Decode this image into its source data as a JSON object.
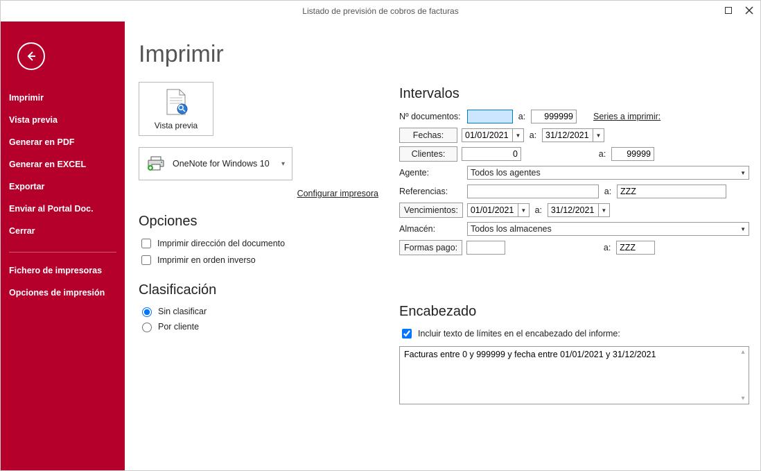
{
  "window": {
    "title": "Listado de previsión de cobros de facturas"
  },
  "sidebar": {
    "items": [
      "Imprimir",
      "Vista previa",
      "Generar en PDF",
      "Generar en EXCEL",
      "Exportar",
      "Enviar al Portal Doc.",
      "Cerrar"
    ],
    "items2": [
      "Fichero de impresoras",
      "Opciones de impresión"
    ]
  },
  "page": {
    "heading": "Imprimir",
    "preview_label": "Vista previa",
    "printer_name": "OneNote for Windows 10",
    "config_link": "Configurar impresora"
  },
  "opciones": {
    "heading": "Opciones",
    "cb1": "Imprimir dirección del documento",
    "cb2": "Imprimir en orden inverso"
  },
  "clasificacion": {
    "heading": "Clasificación",
    "r1": "Sin clasificar",
    "r2": "Por cliente"
  },
  "intervalos": {
    "heading": "Intervalos",
    "ndoc_label": "Nº documentos:",
    "ndoc_from": "",
    "a": "a:",
    "ndoc_to": "999999",
    "series_link": "Series a imprimir:",
    "fechas_btn": "Fechas:",
    "fecha_from": "01/01/2021",
    "fecha_to": "31/12/2021",
    "clientes_btn": "Clientes:",
    "clientes_from": "0",
    "clientes_to": "99999",
    "agente_label": "Agente:",
    "agente_value": "Todos los agentes",
    "ref_label": "Referencias:",
    "ref_from": "",
    "ref_to": "ZZZ",
    "venc_btn": "Vencimientos:",
    "venc_from": "01/01/2021",
    "venc_to": "31/12/2021",
    "almacen_label": "Almacén:",
    "almacen_value": "Todos los almacenes",
    "formas_btn": "Formas pago:",
    "formas_from": "",
    "formas_to": "ZZZ"
  },
  "encabezado": {
    "heading": "Encabezado",
    "cb": "Incluir texto de límites en el encabezado del informe:",
    "text": "Facturas entre 0 y 999999 y fecha entre 01/01/2021 y 31/12/2021"
  }
}
